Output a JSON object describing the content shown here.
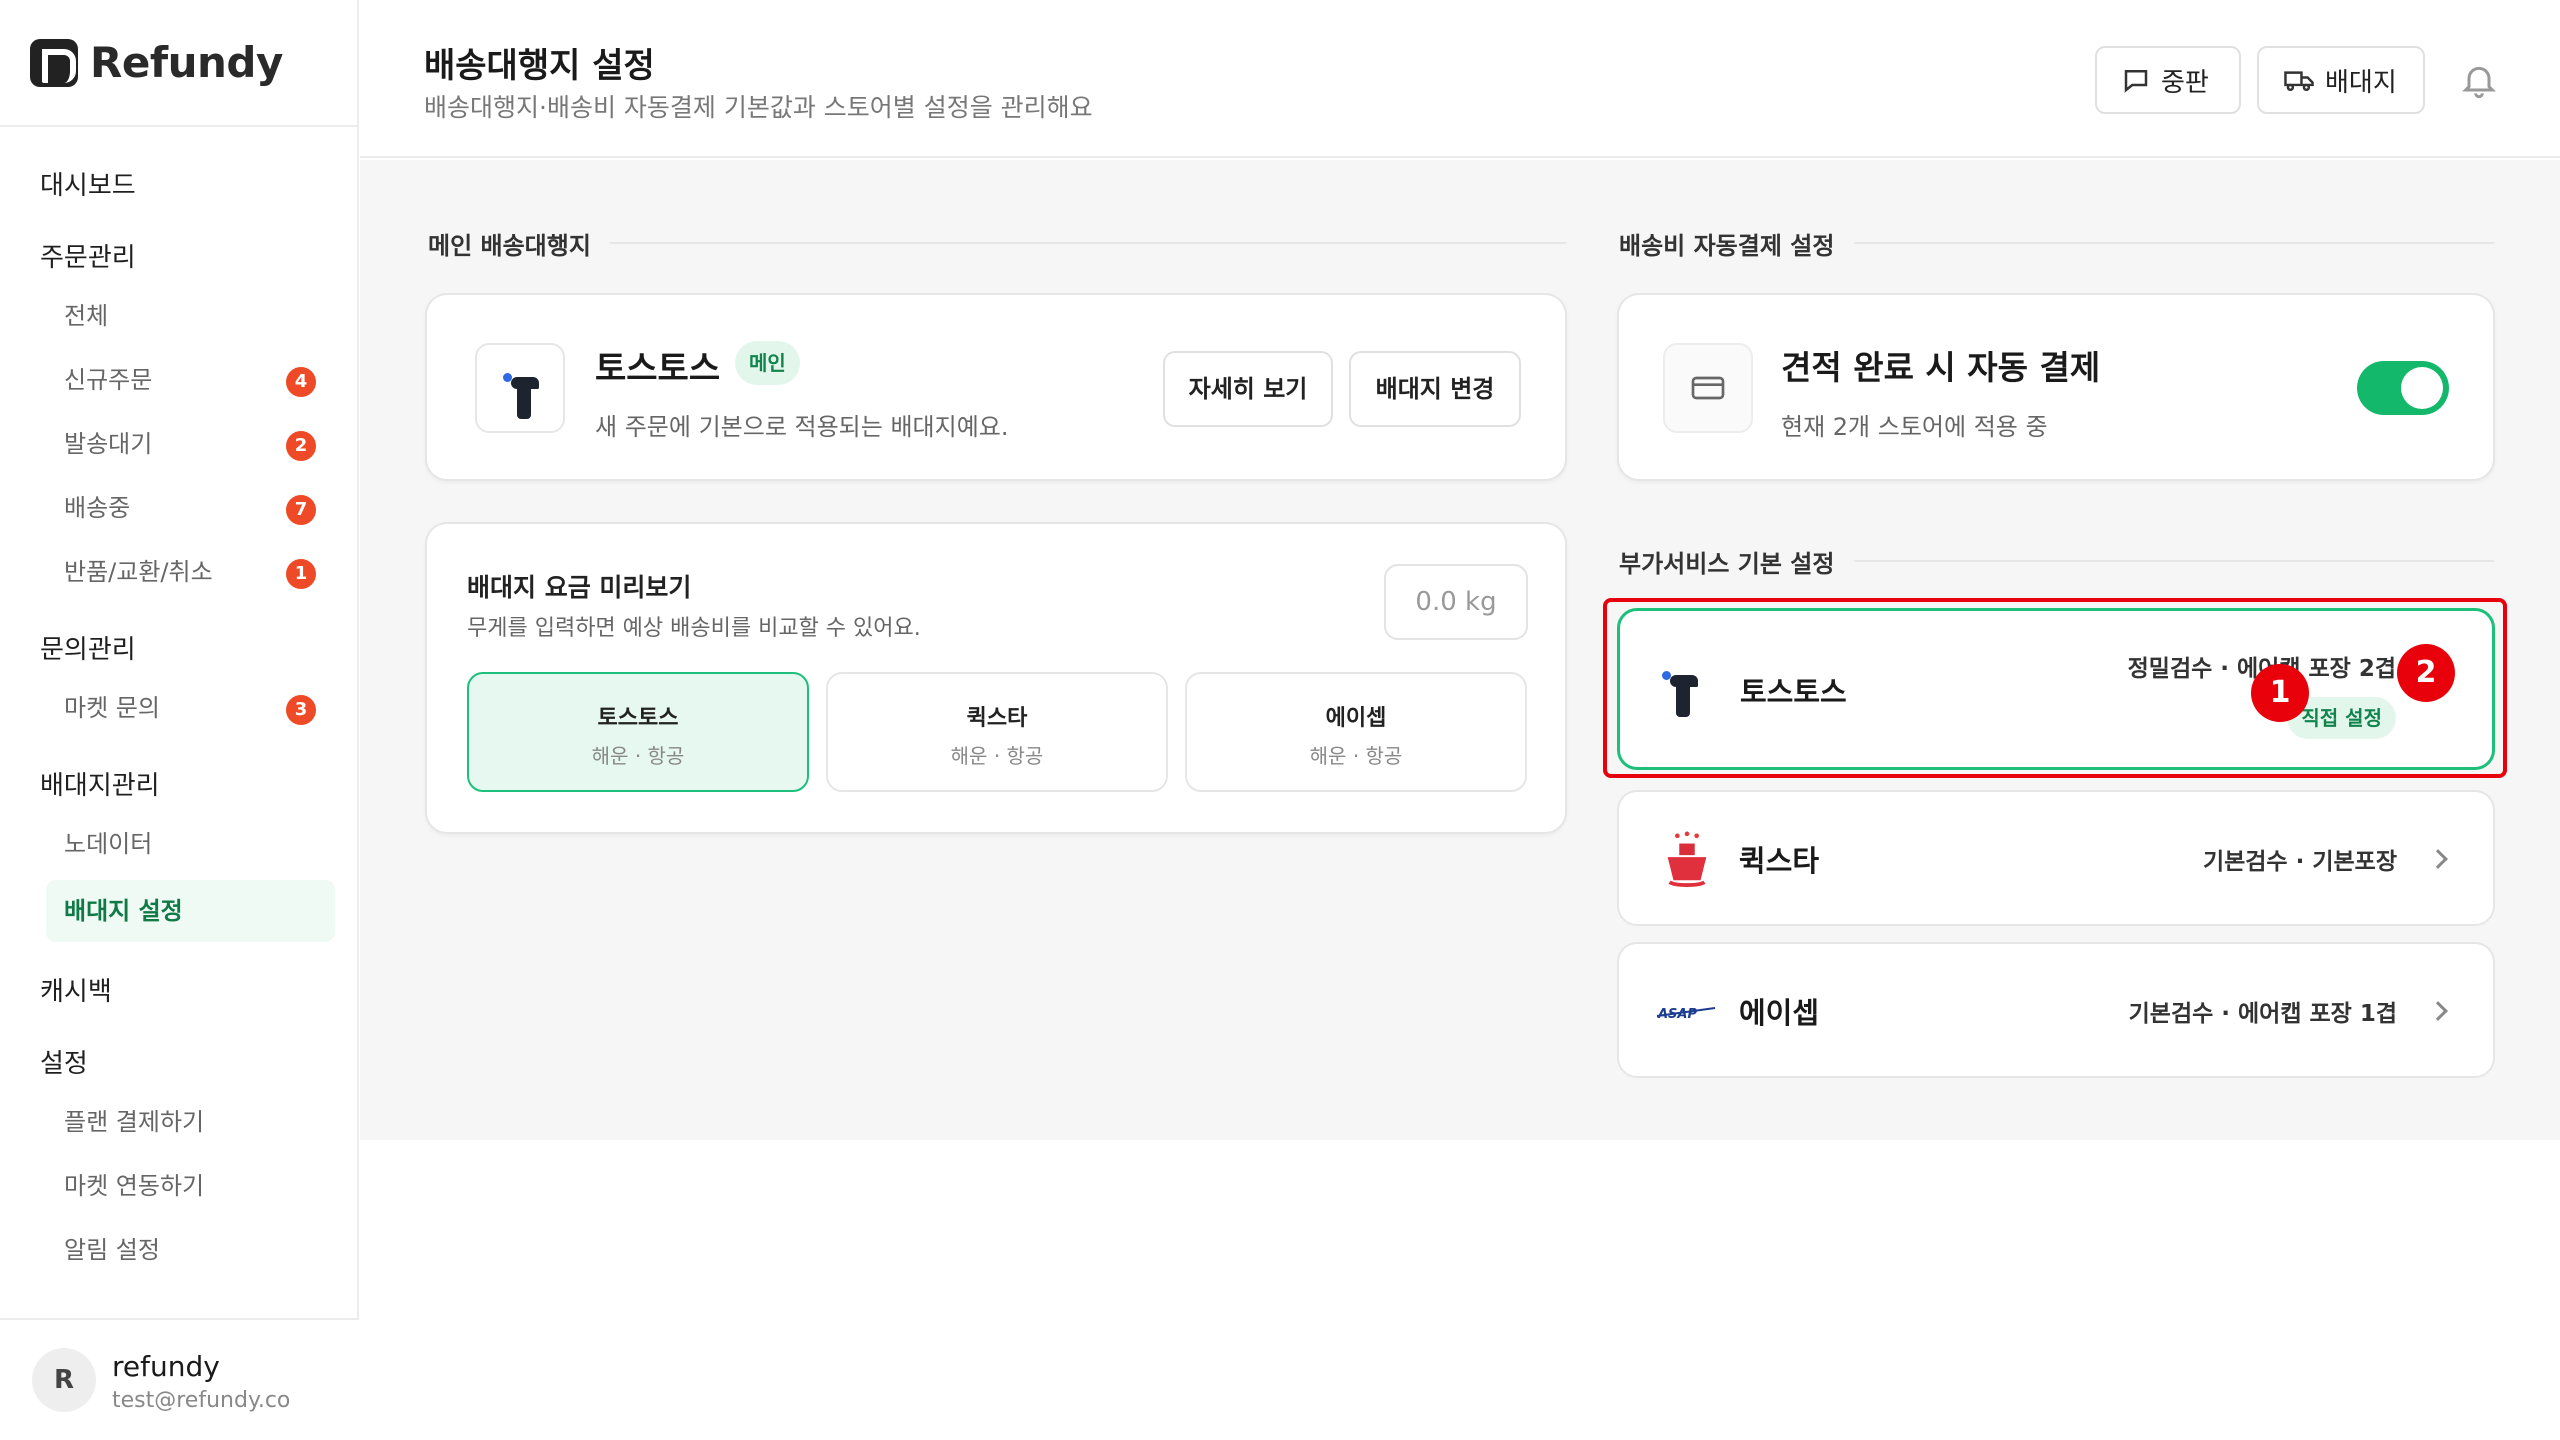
{
  "app": {
    "brand": "Refundy"
  },
  "sidebar": {
    "sections": [
      {
        "label": "대시보드"
      },
      {
        "label": "주문관리"
      },
      {
        "label": "문의관리"
      },
      {
        "label": "배대지관리"
      },
      {
        "label": "캐시백"
      },
      {
        "label": "설정"
      }
    ],
    "orders": [
      {
        "label": "전체"
      },
      {
        "label": "신규주문",
        "badge": "4"
      },
      {
        "label": "발송대기",
        "badge": "2"
      },
      {
        "label": "배송중",
        "badge": "7"
      },
      {
        "label": "반품/교환/취소",
        "badge": "1"
      }
    ],
    "inquiries": [
      {
        "label": "마켓 문의",
        "badge": "3"
      }
    ],
    "forwarders": [
      {
        "label": "노데이터"
      },
      {
        "label": "배대지 설정"
      }
    ],
    "settings": [
      {
        "label": "플랜 결제하기"
      },
      {
        "label": "마켓 연동하기"
      },
      {
        "label": "알림 설정"
      }
    ],
    "user": {
      "initial": "R",
      "name": "refundy",
      "email": "test@refundy.co"
    }
  },
  "header": {
    "title": "배송대행지 설정",
    "subtitle": "배송대행지·배송비 자동결제 기본값과 스토어별 설정을 관리해요",
    "btn_reply": "중판",
    "btn_forwarder": "배대지"
  },
  "main_forwarder": {
    "section_label": "메인 배송대행지",
    "name": "토스토스",
    "tag": "메인",
    "desc": "새 주문에 기본으로 적용되는 배대지예요.",
    "btn_detail": "자세히 보기",
    "btn_change": "배대지 변경"
  },
  "preview": {
    "title": "배대지 요금 미리보기",
    "desc": "무게를 입력하면 예상 배송비를 비교할 수 있어요.",
    "placeholder": "0.0 kg",
    "options": [
      {
        "name": "토스토스",
        "sub": "해운 · 항공"
      },
      {
        "name": "퀵스타",
        "sub": "해운 · 항공"
      },
      {
        "name": "에이셉",
        "sub": "해운 · 항공"
      }
    ]
  },
  "autopay": {
    "section_label": "배송비 자동결제 설정",
    "title": "견적 완료 시 자동 결제",
    "desc": "현재 2개 스토어에 적용 중",
    "enabled": true
  },
  "services": {
    "section_label": "부가서비스 기본 설정",
    "items": [
      {
        "name": "토스토스",
        "detail": "정밀검수 · 에어캡 포장 2겹",
        "tag": "직접 설정"
      },
      {
        "name": "퀵스타",
        "detail": "기본검수 · 기본포장"
      },
      {
        "name": "에이셉",
        "detail": "기본검수 · 에어캡 포장 1겹"
      }
    ]
  },
  "markers": [
    "1",
    "2"
  ],
  "colors": {
    "accent": "#14b86a",
    "badge": "#ef4a27",
    "highlight": "#e8000b"
  }
}
